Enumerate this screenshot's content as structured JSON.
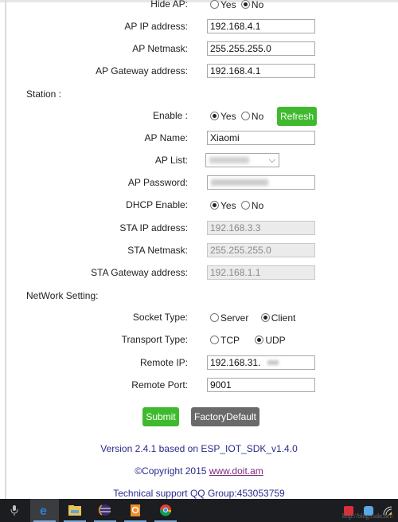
{
  "ap_settings": {
    "hide_ap": {
      "label": "Hide AP:",
      "options": [
        {
          "label": "Yes",
          "selected": false
        },
        {
          "label": "No",
          "selected": true
        }
      ]
    },
    "ip_address": {
      "label": "AP IP address:",
      "value": "192.168.4.1"
    },
    "netmask": {
      "label": "AP Netmask:",
      "value": "255.255.255.0"
    },
    "gateway": {
      "label": "AP Gateway address:",
      "value": "192.168.4.1"
    }
  },
  "station": {
    "title": "Station :",
    "enable": {
      "label": "Enable :",
      "options": [
        {
          "label": "Yes",
          "selected": true
        },
        {
          "label": "No",
          "selected": false
        }
      ],
      "refresh_label": "Refresh"
    },
    "ap_name": {
      "label": "AP Name:",
      "value": "Xiaomi"
    },
    "ap_list": {
      "label": "AP List:",
      "value_redacted": true
    },
    "ap_password": {
      "label": "AP Password:",
      "value_redacted": true
    },
    "dhcp": {
      "label": "DHCP Enable:",
      "options": [
        {
          "label": "Yes",
          "selected": true
        },
        {
          "label": "No",
          "selected": false
        }
      ]
    },
    "sta_ip": {
      "label": "STA IP address:",
      "value": "192.168.3.3"
    },
    "sta_netmask": {
      "label": "STA Netmask:",
      "value": "255.255.255.0"
    },
    "sta_gateway": {
      "label": "STA Gateway address:",
      "value": "192.168.1.1"
    }
  },
  "network": {
    "title": "NetWork Setting:",
    "socket_type": {
      "label": "Socket Type:",
      "options": [
        {
          "label": "Server",
          "selected": false
        },
        {
          "label": "Client",
          "selected": true
        }
      ]
    },
    "transport_type": {
      "label": "Transport Type:",
      "options": [
        {
          "label": "TCP",
          "selected": false
        },
        {
          "label": "UDP",
          "selected": true
        }
      ]
    },
    "remote_ip": {
      "label": "Remote IP:",
      "value": "192.168.31."
    },
    "remote_port": {
      "label": "Remote Port:",
      "value": "9001"
    }
  },
  "actions": {
    "submit_label": "Submit",
    "factory_default_label": "FactoryDefault"
  },
  "footer": {
    "version": "Version 2.4.1 based on ESP_IOT_SDK_v1.4.0",
    "copyright_prefix": "©Copyright 2015 ",
    "copyright_link": "www.doit.am",
    "support": "Technical support QQ Group:453053759"
  },
  "colors": {
    "green_button": "#3fba2e",
    "gray_button": "#6a6a6a",
    "footer_text": "#2a2a8c",
    "link": "#7a2a7a",
    "taskbar": "#1c1d20"
  },
  "taskbar": {
    "items": [
      {
        "icon": "microphone-icon",
        "active": false
      },
      {
        "icon": "edge-browser-icon",
        "active": true
      },
      {
        "icon": "file-explorer-icon",
        "active": false
      },
      {
        "icon": "eclipse-ide-icon",
        "active": false
      },
      {
        "icon": "orange-app-icon",
        "active": false
      },
      {
        "icon": "chrome-icon",
        "active": false
      }
    ],
    "tray": [
      {
        "icon": "red-app-tray-icon"
      },
      {
        "icon": "cloud-tray-icon"
      },
      {
        "icon": "wifi-tray-icon"
      }
    ],
    "watermark": "http://blog.csdn.net/"
  }
}
